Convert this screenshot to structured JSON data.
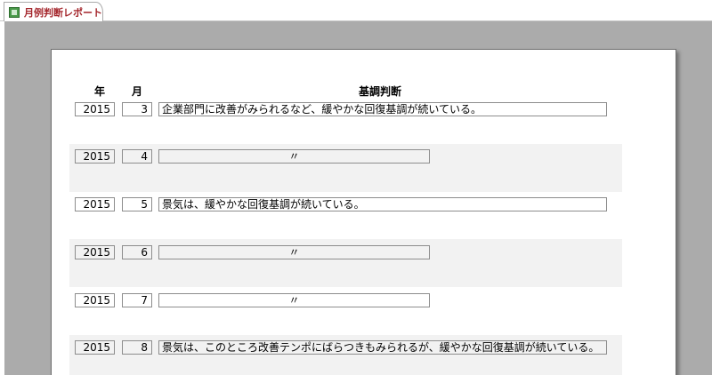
{
  "tab": {
    "label": "月例判断レポート"
  },
  "report": {
    "headers": {
      "year": "年",
      "month": "月",
      "judgement": "基調判断"
    },
    "rows": [
      {
        "year": "2015",
        "month": "3",
        "judgement": "企業部門に改善がみられるなど、緩やかな回復基調が続いている。"
      },
      {
        "year": "2015",
        "month": "4",
        "judgement": "〃"
      },
      {
        "year": "2015",
        "month": "5",
        "judgement": "景気は、緩やかな回復基調が続いている。"
      },
      {
        "year": "2015",
        "month": "6",
        "judgement": "〃"
      },
      {
        "year": "2015",
        "month": "7",
        "judgement": "〃"
      },
      {
        "year": "2015",
        "month": "8",
        "judgement": "景気は、このところ改善テンポにばらつきもみられるが、緩やかな回復基調が続いている。"
      }
    ]
  }
}
